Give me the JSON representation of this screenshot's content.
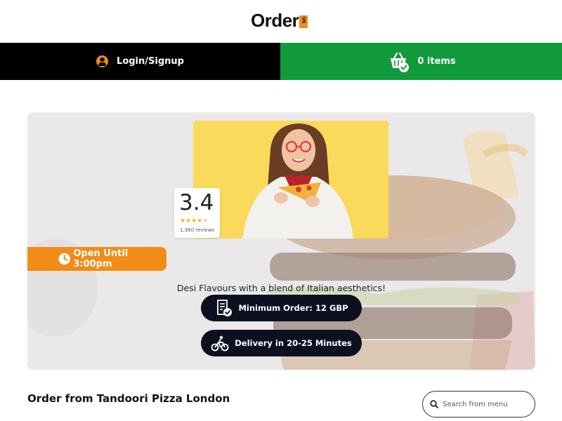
{
  "brand": {
    "logo_text": "Order",
    "logo_badge": "UK",
    "accent_color": "#f28c17",
    "cart_color": "#119a3b"
  },
  "nav": {
    "login_label": "Login/Signup",
    "login_icon": "user-icon",
    "cart_label": "0 items",
    "cart_icon": "basket-check-icon"
  },
  "hero": {
    "rating": {
      "value": "3.4",
      "stars": 3.5,
      "stars_text": "★★★★★",
      "reviews": "1,360 reviews"
    },
    "open_status": "Open Until 3:00pm",
    "tagline": "Desi Flavours with a blend of Italian aesthetics!",
    "minimum_order": "Minimum Order: 12 GBP",
    "delivery_time": "Delivery in 20-25 Minutes"
  },
  "menu": {
    "title": "Order from Tandoori Pizza London",
    "search_placeholder": "Search from menu"
  }
}
